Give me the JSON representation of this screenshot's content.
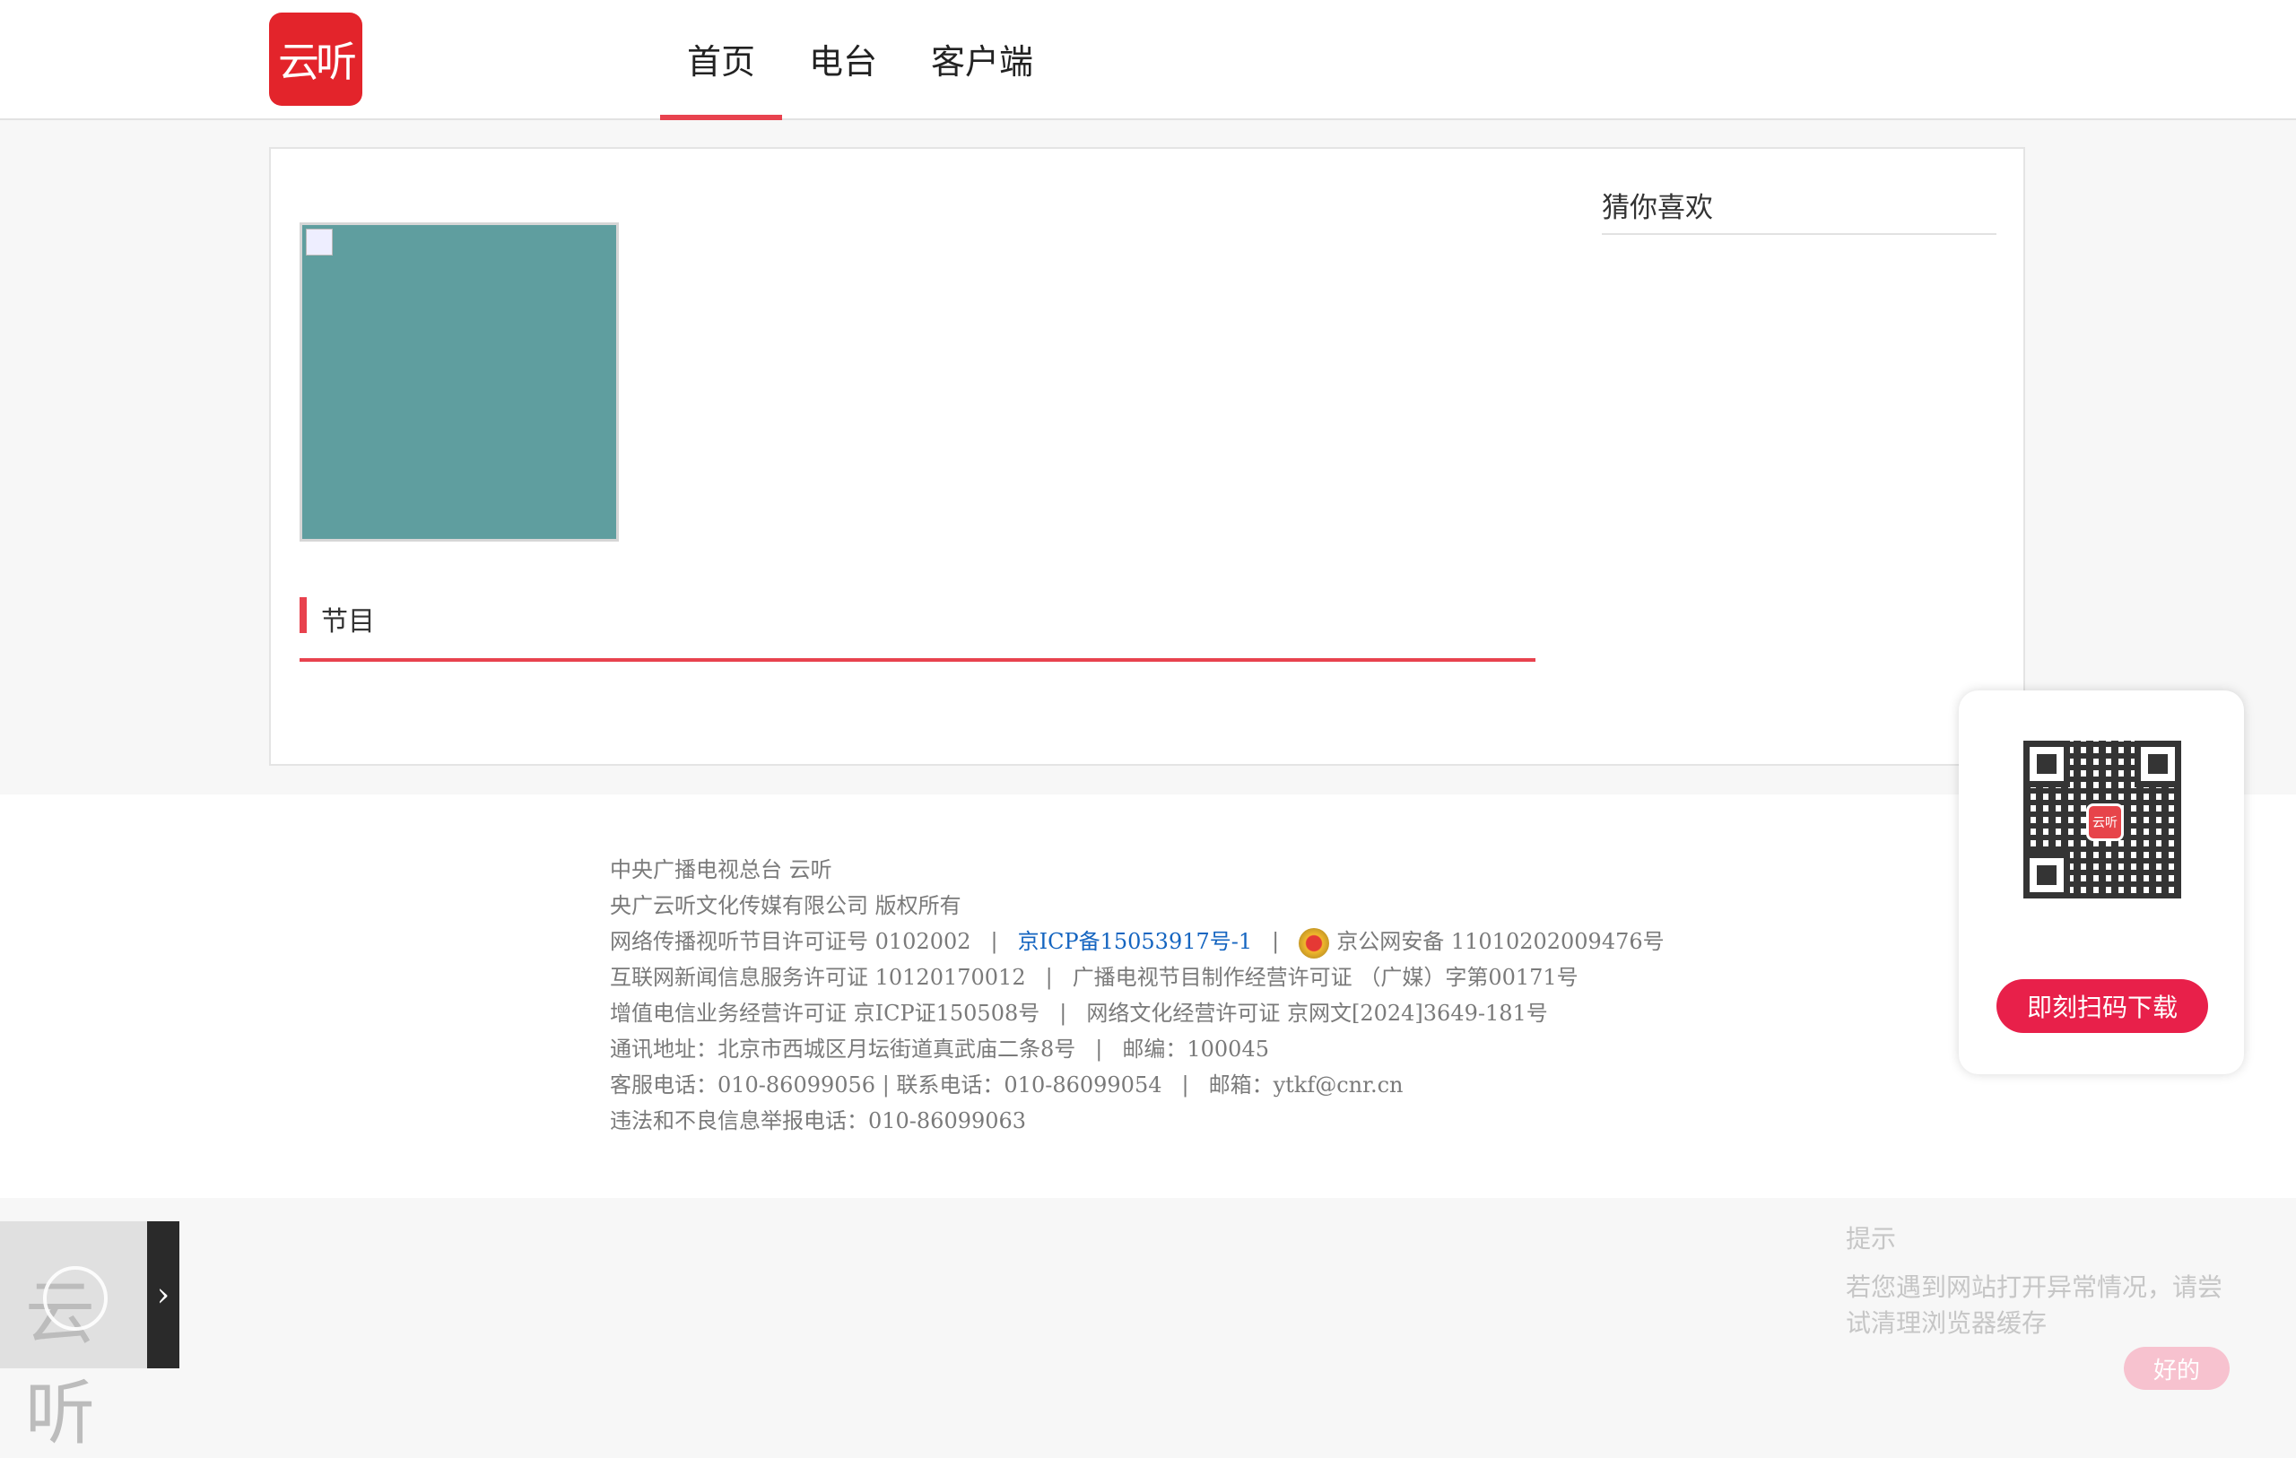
{
  "header": {
    "logo_text": "云听",
    "nav": [
      {
        "label": "首页",
        "active": true
      },
      {
        "label": "电台",
        "active": false
      },
      {
        "label": "客户端",
        "active": false
      }
    ]
  },
  "main": {
    "section_title": "节目",
    "sidebar_title": "猜你喜欢"
  },
  "footer": {
    "line1": "中央广播电视总台 云听",
    "line2": "央广云听文化传媒有限公司 版权所有",
    "license_av": "网络传播视听节目许可证号 0102002",
    "icp": "京ICP备15053917号-1",
    "police": "京公网安备 11010202009476号",
    "news_license": "互联网新闻信息服务许可证 10120170012",
    "tv_license": "广播电视节目制作经营许可证 （广媒）字第00171号",
    "telecom_license": "增值电信业务经营许可证 京ICP证150508号",
    "culture_license": "网络文化经营许可证 京网文[2024]3649-181号",
    "address": "通讯地址：北京市西城区月坛街道真武庙二条8号",
    "postcode": "邮编：100045",
    "service_phone": "客服电话：010-86099056 | 联系电话：010-86099054",
    "email": "邮箱：ytkf@cnr.cn",
    "report_phone": "违法和不良信息举报电话：010-86099063",
    "separator": "|"
  },
  "qr_card": {
    "center_logo": "云听",
    "button": "即刻扫码下载"
  },
  "tip": {
    "title": "提示",
    "message": "若您遇到网站打开异常情况，请尝试清理浏览器缓存",
    "ok": "好的"
  },
  "mini_player": {
    "logo_text": "云听",
    "toggle": "›"
  },
  "colors": {
    "brand_red": "#e3242b",
    "accent_red": "#e8424e",
    "cover_teal": "#5f9e9f",
    "link_blue": "#1565c0"
  }
}
